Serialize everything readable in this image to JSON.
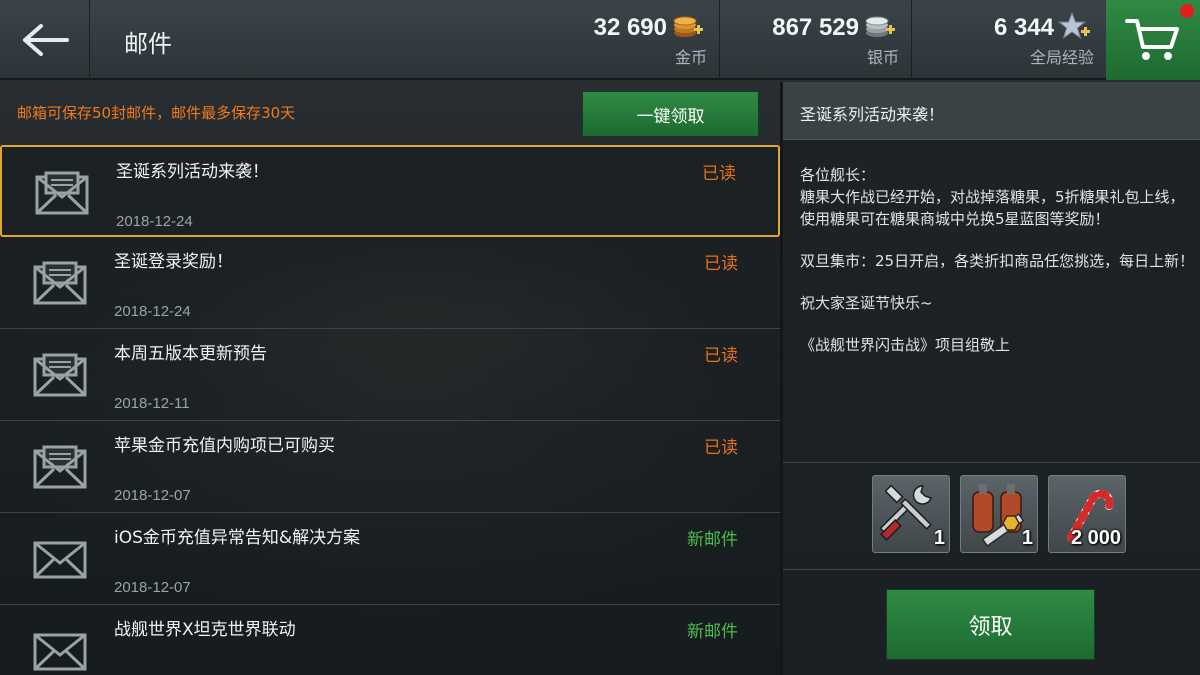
{
  "header": {
    "title": "邮件",
    "gold": {
      "value": "32 690",
      "label": "金币"
    },
    "silver": {
      "value": "867 529",
      "label": "银币"
    },
    "xp": {
      "value": "6 344",
      "label": "全局经验"
    }
  },
  "mailbox": {
    "notice": "邮箱可保存50封邮件，邮件最多保存30天",
    "claim_all_label": "一键领取",
    "items": [
      {
        "subject": "圣诞系列活动来袭！",
        "date": "2018-12-24",
        "status": "已读",
        "is_new": false,
        "opened": true,
        "selected": true
      },
      {
        "subject": "圣诞登录奖励！",
        "date": "2018-12-24",
        "status": "已读",
        "is_new": false,
        "opened": true,
        "selected": false
      },
      {
        "subject": "本周五版本更新预告",
        "date": "2018-12-11",
        "status": "已读",
        "is_new": false,
        "opened": true,
        "selected": false
      },
      {
        "subject": "苹果金币充值内购项已可购买",
        "date": "2018-12-07",
        "status": "已读",
        "is_new": false,
        "opened": true,
        "selected": false
      },
      {
        "subject": "iOS金币充值异常告知&解决方案",
        "date": "2018-12-07",
        "status": "新邮件",
        "is_new": true,
        "opened": false,
        "selected": false
      },
      {
        "subject": "战舰世界X坦克世界联动",
        "date": "",
        "status": "新邮件",
        "is_new": true,
        "opened": false,
        "selected": false
      }
    ]
  },
  "detail": {
    "title": "圣诞系列活动来袭！",
    "body": [
      "各位舰长：",
      "糖果大作战已经开始，对战掉落糖果，5折糖果礼包上线，使用糖果可在糖果商城中兑换5星蓝图等奖励！",
      "",
      "双旦集市：25日开启，各类折扣商品任您挑选，每日上新！",
      "",
      "祝大家圣诞节快乐~",
      "",
      "《战舰世界闪击战》项目组敬上"
    ],
    "rewards": [
      {
        "icon": "repair-tools-icon",
        "qty": "1"
      },
      {
        "icon": "damage-control-icon",
        "qty": "1"
      },
      {
        "icon": "candy-cane-icon",
        "qty": "2 000"
      }
    ],
    "claim_label": "领取"
  },
  "colors": {
    "accent_green": "#2f8b45",
    "read_orange": "#e86f1c",
    "new_green": "#4cbc4f",
    "selected_border": "#e3a52a",
    "notice_orange": "#f07a1c",
    "cart_badge": "#e02020"
  }
}
